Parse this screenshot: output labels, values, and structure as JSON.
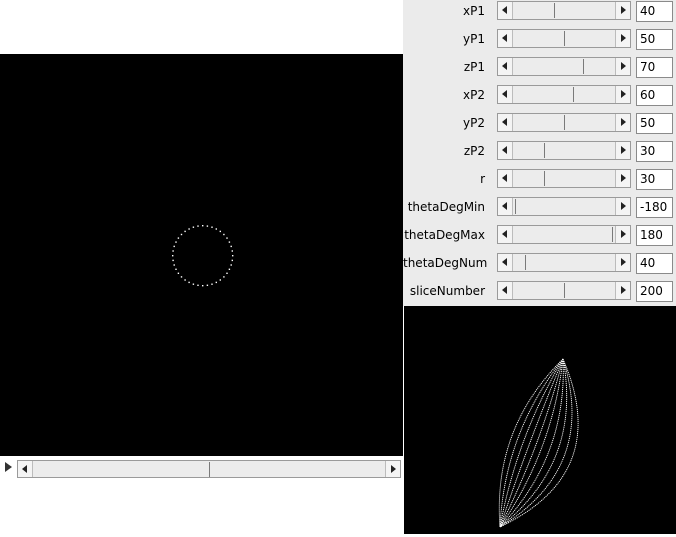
{
  "controls": [
    {
      "label": "xP1",
      "value": "40",
      "slider_fraction": 0.4
    },
    {
      "label": "yP1",
      "value": "50",
      "slider_fraction": 0.5
    },
    {
      "label": "zP1",
      "value": "70",
      "slider_fraction": 0.7
    },
    {
      "label": "xP2",
      "value": "60",
      "slider_fraction": 0.6
    },
    {
      "label": "yP2",
      "value": "50",
      "slider_fraction": 0.5
    },
    {
      "label": "zP2",
      "value": "30",
      "slider_fraction": 0.3
    },
    {
      "label": "r",
      "value": "30",
      "slider_fraction": 0.3
    },
    {
      "label": "thetaDegMin",
      "value": "-180",
      "slider_fraction": 0.0
    },
    {
      "label": "thetaDegMax",
      "value": "180",
      "slider_fraction": 1.0
    },
    {
      "label": "thetaDegNum",
      "value": "40",
      "slider_fraction": 0.1
    },
    {
      "label": "sliceNumber",
      "value": "200",
      "slider_fraction": 0.5
    }
  ],
  "colors": {
    "view_background": "#000000",
    "drawing": "#ffffff",
    "panel_background": "#ebebeb"
  },
  "icons": {
    "play": "play-icon",
    "arrow_left": "arrow-left-icon",
    "arrow_right": "arrow-right-icon"
  },
  "bottom_slider": {
    "fraction": 0.5
  }
}
